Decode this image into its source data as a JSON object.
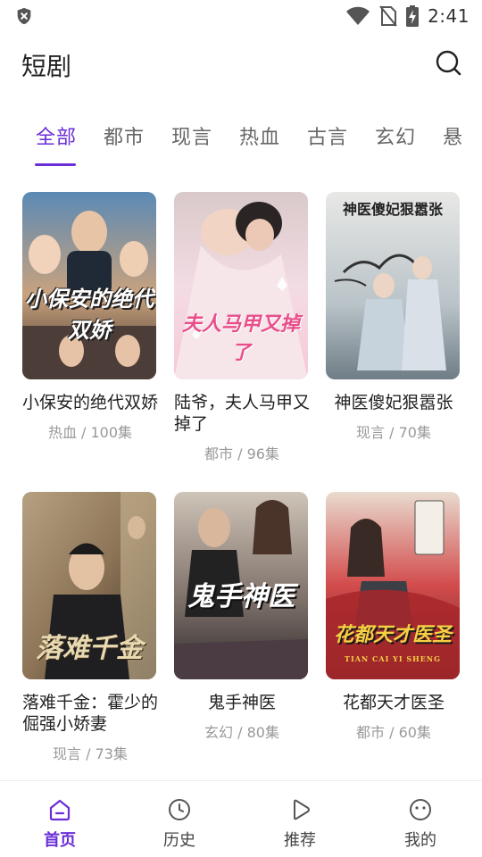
{
  "status_bar": {
    "time": "2:41",
    "icons": [
      "shield-icon",
      "wifi-icon",
      "no-sim-icon",
      "battery-charging-icon"
    ]
  },
  "header": {
    "title": "短剧",
    "search_icon": "search-icon"
  },
  "tabs": [
    {
      "label": "全部",
      "active": true
    },
    {
      "label": "都市",
      "active": false
    },
    {
      "label": "现言",
      "active": false
    },
    {
      "label": "热血",
      "active": false
    },
    {
      "label": "古言",
      "active": false
    },
    {
      "label": "玄幻",
      "active": false
    },
    {
      "label": "悬",
      "active": false
    }
  ],
  "dramas": [
    {
      "title": "小保安的绝代双娇",
      "meta": "热血 / 100集",
      "cover_text": "小保安的绝代双娇"
    },
    {
      "title": "陆爷，夫人马甲又掉了",
      "meta": "都市 / 96集",
      "cover_text": "夫人马甲又掉了"
    },
    {
      "title": "神医傻妃狠嚣张",
      "meta": "现言 / 70集",
      "cover_text": "神医傻妃狠嚣张"
    },
    {
      "title": "落难千金：霍少的倔强小娇妻",
      "meta": "现言 / 73集",
      "cover_text": "落难千金"
    },
    {
      "title": "鬼手神医",
      "meta": "玄幻 / 80集",
      "cover_text": "鬼手神医"
    },
    {
      "title": "花都天才医圣",
      "meta": "都市 / 60集",
      "cover_text": "花都天才医圣",
      "cover_subtext": "TIAN CAI YI SHENG"
    }
  ],
  "bottom_nav": [
    {
      "label": "首页",
      "icon": "home-icon",
      "active": true
    },
    {
      "label": "历史",
      "icon": "clock-icon",
      "active": false
    },
    {
      "label": "推荐",
      "icon": "play-icon",
      "active": false
    },
    {
      "label": "我的",
      "icon": "smile-icon",
      "active": false
    }
  ],
  "colors": {
    "accent": "#6a2ed6",
    "text_primary": "#222222",
    "text_secondary": "#999999",
    "tab_inactive": "#666666"
  }
}
